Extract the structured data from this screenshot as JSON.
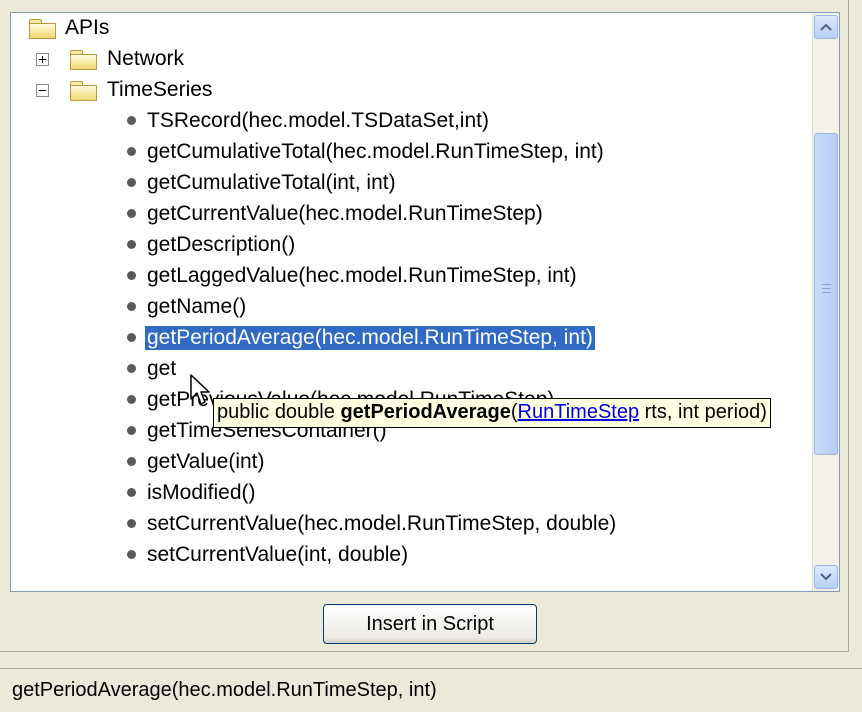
{
  "tree": {
    "root": {
      "label": "APIs",
      "icon": "folder-icon"
    },
    "groups": [
      {
        "label": "Network",
        "expanded": false
      },
      {
        "label": "TimeSeries",
        "expanded": true
      }
    ],
    "methods": [
      "TSRecord(hec.model.TSDataSet,int)",
      "getCumulativeTotal(hec.model.RunTimeStep, int)",
      "getCumulativeTotal(int, int)",
      "getCurrentValue(hec.model.RunTimeStep)",
      "getDescription()",
      "getLaggedValue(hec.model.RunTimeStep, int)",
      "getName()",
      "getPeriodAverage(hec.model.RunTimeStep, int)",
      "get",
      "getPreviousValue(hec.model.RunTimeStep)",
      "getTimeSeriesContainer()",
      "getValue(int)",
      "isModified()",
      "setCurrentValue(hec.model.RunTimeStep, double)",
      "setCurrentValue(int, double)"
    ],
    "selected_method": "getPeriodAverage(hec.model.RunTimeStep, int)"
  },
  "tooltip": {
    "prefix": "public double ",
    "method": "getPeriodAverage",
    "open_paren": "(",
    "link": "RunTimeStep",
    "rest": " rts, int period)"
  },
  "button": {
    "label": "Insert in Script"
  },
  "status": {
    "text": "getPeriodAverage(hec.model.RunTimeStep, int)"
  },
  "colors": {
    "selection": "#316ac5",
    "tooltip_bg": "#ffffe1",
    "folder": "#f0d770"
  }
}
